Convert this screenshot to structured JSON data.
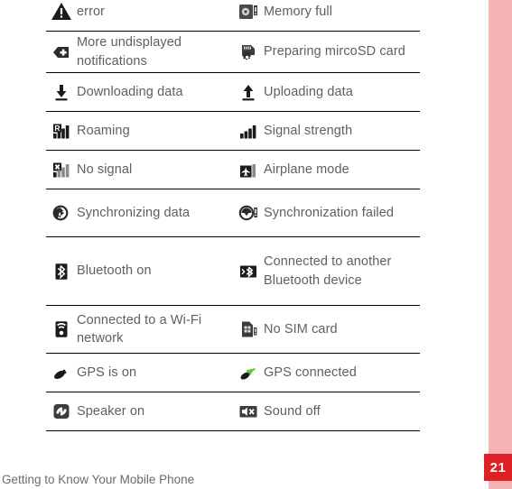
{
  "page": {
    "footer_text": "Getting to Know Your Mobile Phone",
    "page_number": "21",
    "accent_color": "#dd2026",
    "band_color": "#f4b4b4",
    "text_color": "#5f5f5f"
  },
  "icon_table": {
    "rows": [
      {
        "left": {
          "icon": "warning-triangle-icon",
          "label": "error"
        },
        "right": {
          "icon": "memory-full-icon",
          "label": "Memory full"
        }
      },
      {
        "left": {
          "icon": "more-notifications-icon",
          "label": "More undisplayed notifications"
        },
        "right": {
          "icon": "preparing-microsd-icon",
          "label": "Preparing mircoSD card"
        }
      },
      {
        "left": {
          "icon": "download-arrow-icon",
          "label": "Downloading data"
        },
        "right": {
          "icon": "upload-arrow-icon",
          "label": "Uploading data"
        }
      },
      {
        "left": {
          "icon": "roaming-signal-icon",
          "label": "Roaming"
        },
        "right": {
          "icon": "signal-strength-icon",
          "label": "Signal strength"
        }
      },
      {
        "left": {
          "icon": "no-signal-icon",
          "label": "No signal"
        },
        "right": {
          "icon": "airplane-mode-icon",
          "label": "Airplane mode"
        }
      },
      {
        "left": {
          "icon": "sync-icon",
          "label": "Synchronizing data"
        },
        "right": {
          "icon": "sync-failed-icon",
          "label": "Synchronization failed"
        }
      },
      {
        "left": {
          "icon": "bluetooth-on-icon",
          "label": "Bluetooth on"
        },
        "right": {
          "icon": "bluetooth-connected-icon",
          "label": "Connected to another Bluetooth device"
        }
      },
      {
        "left": {
          "icon": "wifi-connected-icon",
          "label": "Connected to a Wi-Fi network"
        },
        "right": {
          "icon": "no-sim-card-icon",
          "label": "No SIM card"
        }
      },
      {
        "left": {
          "icon": "gps-on-icon",
          "label": "GPS is on"
        },
        "right": {
          "icon": "gps-connected-icon",
          "label": "GPS connected"
        }
      },
      {
        "left": {
          "icon": "speaker-on-icon",
          "label": "Speaker on"
        },
        "right": {
          "icon": "sound-off-icon",
          "label": "Sound off"
        }
      }
    ]
  }
}
